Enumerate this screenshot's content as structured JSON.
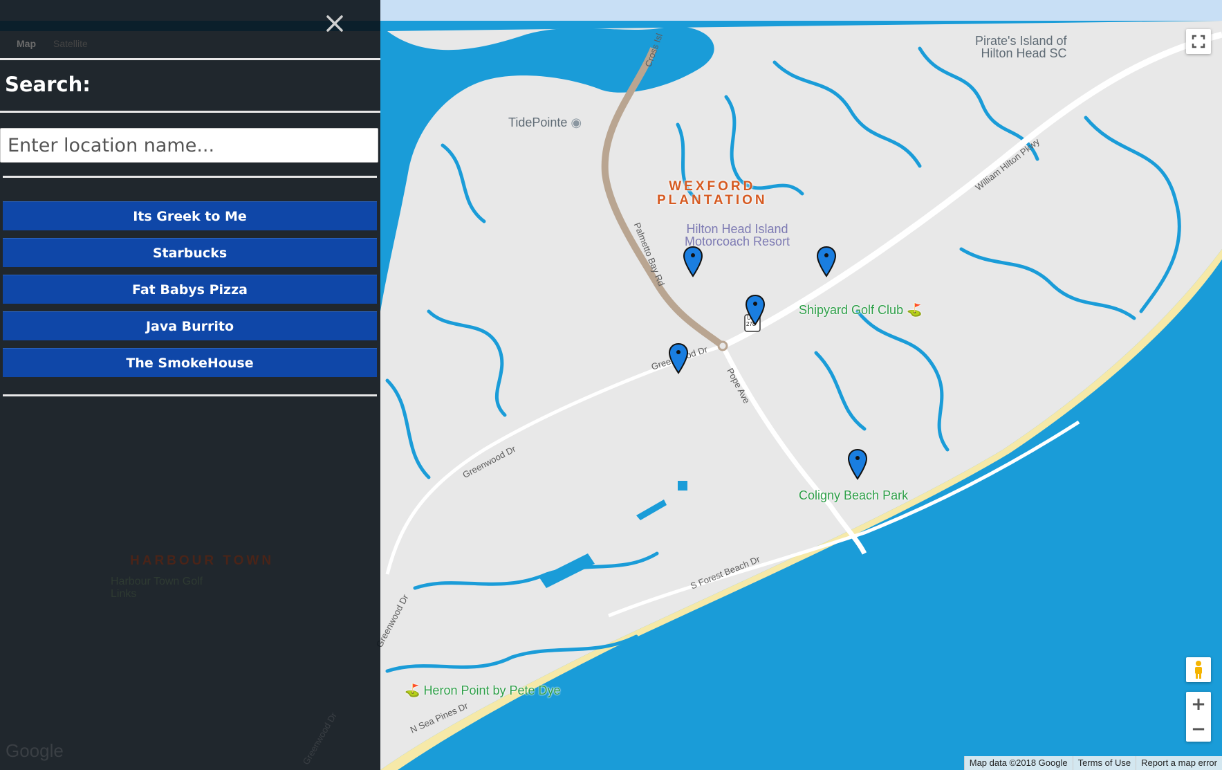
{
  "sidebar": {
    "map_type_buttons": [
      "Map",
      "Satellite"
    ],
    "search_title": "Search:",
    "search_placeholder": "Enter location name...",
    "locations": [
      "Its Greek to Me",
      "Starbucks",
      "Fat Babys Pizza",
      "Java Burrito",
      "The SmokeHouse"
    ],
    "background_labels": {
      "area": "HARBOUR TOWN",
      "golf": "Harbour Town Golf Links",
      "logo": "Google",
      "road": "Greenwood Dr"
    }
  },
  "map": {
    "area_label": [
      "WEXFORD",
      "PLANTATION"
    ],
    "pois": {
      "tidepointe": "TidePointe",
      "pirates_island": [
        "Pirate's Island of",
        "Hilton Head SC"
      ],
      "motorcoach": [
        "Hilton Head Island",
        "Motorcoach Resort"
      ],
      "shipyard": "Shipyard Golf Club",
      "coligny": "Coligny Beach Park",
      "heron_point": "Heron Point by Pete Dye"
    },
    "roads": {
      "cross_island": "Cross Isl",
      "palmetto_bay": "Palmetto Bay Rd",
      "william_hilton": "William Hilton Pkwy",
      "pope_ave": "Pope Ave",
      "greenwood_1": "Greenwood Dr",
      "greenwood_2": "Greenwood Dr",
      "greenwood_3": "Greenwood Dr",
      "s_forest_beach": "S Forest Beach Dr",
      "n_sea_pines": "N Sea Pines Dr",
      "us_shield": "US",
      "us_number": "278"
    },
    "footer": [
      "Map data ©2018 Google",
      "Terms of Use",
      "Report a map error"
    ],
    "colors": {
      "water": "#1a9cd8",
      "land": "#e8e8e8",
      "marker": "#1565c0",
      "button": "#0f47a8"
    }
  }
}
